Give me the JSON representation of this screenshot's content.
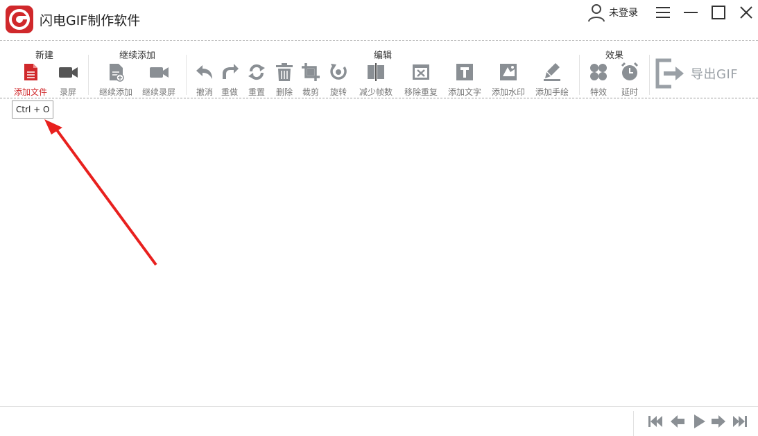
{
  "app": {
    "title": "闪电GIF制作软件"
  },
  "user": {
    "label": "未登录",
    "icon": "user-icon"
  },
  "window_controls": [
    "menu-icon",
    "minimize-icon",
    "maximize-icon",
    "close-icon"
  ],
  "toolbar": {
    "groups": {
      "new": "新建",
      "continue": "继续添加",
      "edit": "编辑",
      "effects": "效果"
    },
    "tools": {
      "add_file": "添加文件",
      "record": "录屏",
      "continue_add": "继续添加",
      "continue_record": "继续录屏",
      "undo": "撤消",
      "redo": "重做",
      "reset": "重置",
      "delete": "删除",
      "crop": "裁剪",
      "rotate": "旋转",
      "reduce_frames": "减少帧数",
      "remove_duplicates": "移除重复",
      "add_text": "添加文字",
      "add_watermark": "添加水印",
      "add_drawing": "添加手绘",
      "effects": "特效",
      "delay": "延时"
    },
    "export_label": "导出GIF"
  },
  "tooltip": {
    "text": "Ctrl + O"
  },
  "playback_controls": [
    "first-frame-icon",
    "previous-frame-icon",
    "play-icon",
    "next-frame-icon",
    "last-frame-icon"
  ],
  "colors": {
    "accent": "#d0282b",
    "icon_gray": "#8a8f94",
    "annotation": "#e8201e"
  }
}
